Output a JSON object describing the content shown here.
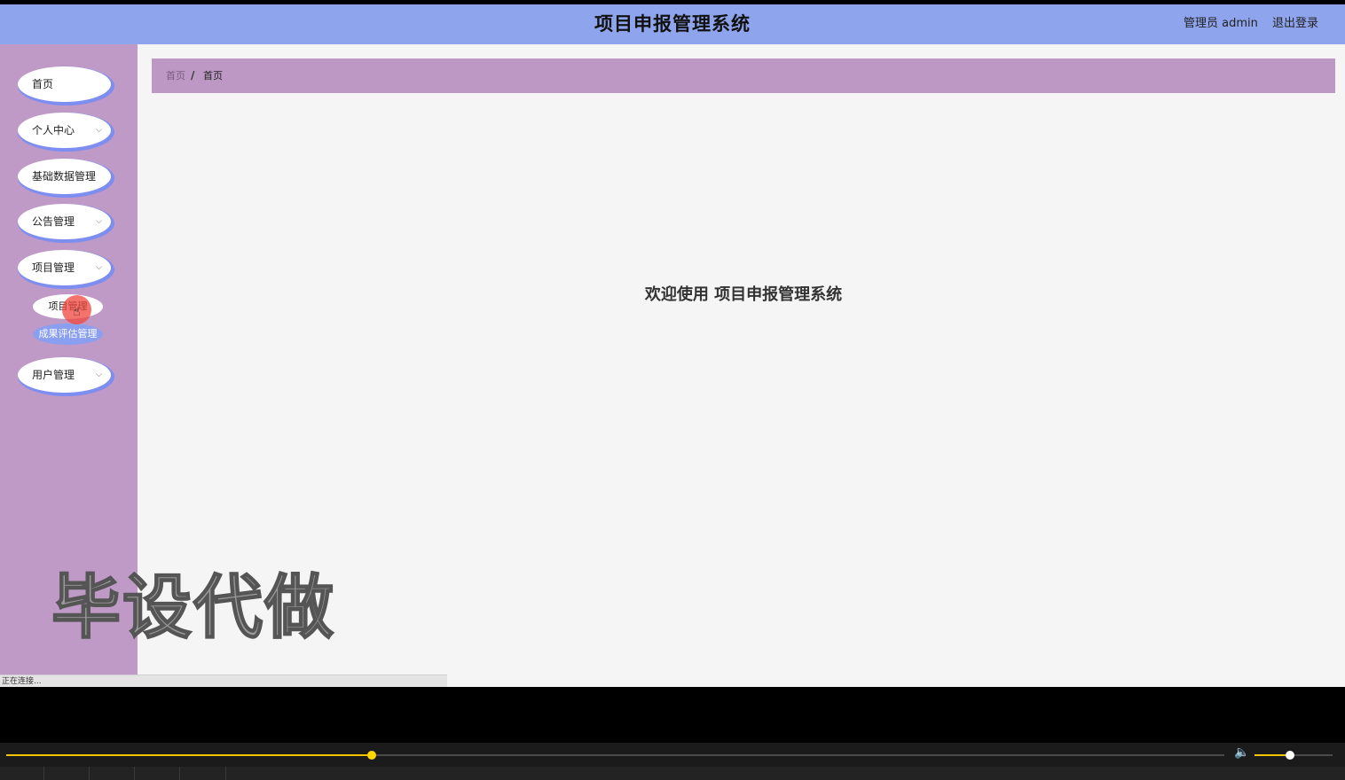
{
  "header": {
    "title": "项目申报管理系统",
    "user_label": "管理员 admin",
    "logout_label": "退出登录"
  },
  "sidebar": {
    "items": [
      {
        "label": "首页",
        "has_chevron": false
      },
      {
        "label": "个人中心",
        "has_chevron": true
      },
      {
        "label": "基础数据管理",
        "has_chevron": false
      },
      {
        "label": "公告管理",
        "has_chevron": true
      },
      {
        "label": "项目管理",
        "has_chevron": true
      },
      {
        "label": "用户管理",
        "has_chevron": true
      }
    ],
    "sub_items": [
      {
        "label": "项目管理"
      },
      {
        "label": "成果评估管理"
      }
    ],
    "chevron": "⌵"
  },
  "breadcrumb": {
    "items": [
      "首页",
      "首页"
    ],
    "separator": "/"
  },
  "main": {
    "welcome": "欢迎使用 项目申报管理系统"
  },
  "watermark": "毕设代做",
  "status": {
    "text": "正在连接..."
  },
  "player": {
    "progress": 0.3,
    "volume": 0.45
  },
  "colors": {
    "header_bg": "#8ea4ec",
    "sidebar_bg": "#c09ac7",
    "accent": "#7e8ef0",
    "seek": "#f2c400"
  }
}
